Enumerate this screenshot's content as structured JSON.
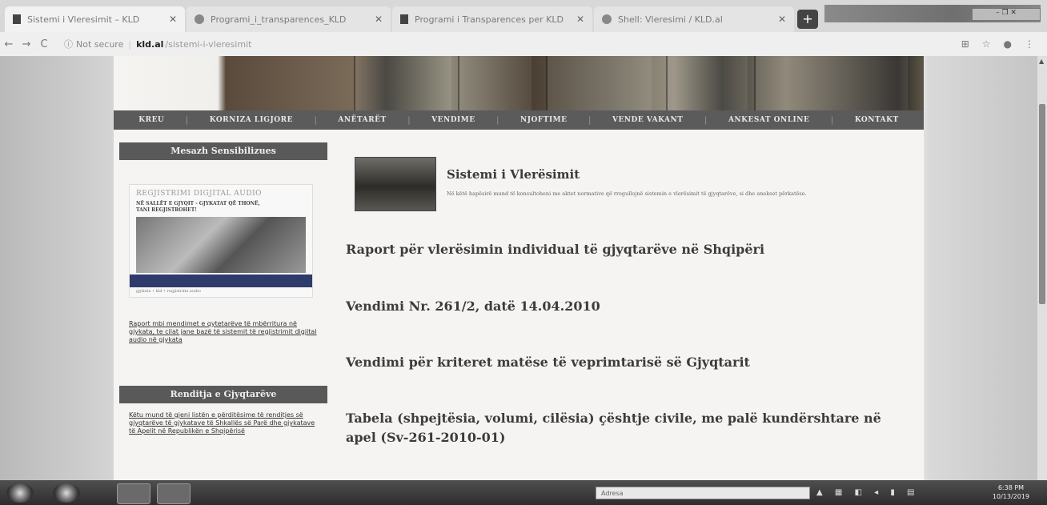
{
  "browser": {
    "tabs": [
      {
        "label": "Sistemi i Vleresimit – KLD"
      },
      {
        "label": "Programi_i_transparences_KLD"
      },
      {
        "label": "Programi i Transparences per KLD"
      },
      {
        "label": "Shell: Vleresimi / KLD.al"
      }
    ],
    "new_tab": "+",
    "window_controls": "– ❐ ✕",
    "security": "Not secure",
    "host": "kld.al",
    "path": "/sistemi-i-vleresimit",
    "nav": {
      "back": "←",
      "forward": "→",
      "reload": "C"
    },
    "toolbar_icons": [
      "⊞",
      "☆",
      "●",
      "⋮"
    ]
  },
  "site": {
    "menu": [
      "KREU",
      "KORNIZA LIGJORE",
      "ANËTARËT",
      "VENDIME",
      "NJOFTIME",
      "VENDE VAKANT",
      "ANKESAT ONLINE",
      "KONTAKT"
    ],
    "sidebar": {
      "header1": "Mesazh Sensibilizues",
      "promo": {
        "title": "REGJISTRIMI DIGJITAL AUDIO",
        "line1": "NË SALLËT E GJYQIT - GJYKATAT QË THONË,",
        "line2": "TANI REGJISTROHET!",
        "footer": "gjykata • kld • regjistrimi audio"
      },
      "link1": "Raport mbi mendimet e qytetarëve të mbërritura në gjykata, te cilat jane bazë të sistemit të regjistrimit digjital audio në gjykata",
      "header2": "Renditja e Gjyqtarëve",
      "link2": "Këtu mund të gjeni listën e përditësime të renditjes së gjyqtarëve të gjykatave të Shkallës së Parë dhe gjykatave të Apelit në Republikën e Shqipërisë"
    },
    "main": {
      "title": "Sistemi i Vlerësimit",
      "description": "Në këtë hapësirë mund të konsultoheni me aktet normative që rregullojnë sistemin e vlerësimit të gjyqtarëve, si dhe anekset përkatëse.",
      "items": [
        "Raport për vlerësimin individual të gjyqtarëve në Shqipëri",
        "Vendimi Nr. 261/2, datë 14.04.2010",
        "Vendimi për kriteret matëse të veprimtarisë së Gjyqtarit",
        "Tabela (shpejtësia, volumi, cilësia) çështje civile, me palë kundërshtare në apel (Sv-261-2010-01)"
      ]
    }
  },
  "taskbar": {
    "search_placeholder": "Adresa",
    "tray": "▲ ▦ ◧ ◂ ▮ ▤",
    "time": "6:38 PM",
    "date": "10/13/2019"
  },
  "colors": {
    "menu_bg": "#5b5b5b",
    "sidebar_header": "#595959",
    "page_bg": "#f5f4f2"
  }
}
